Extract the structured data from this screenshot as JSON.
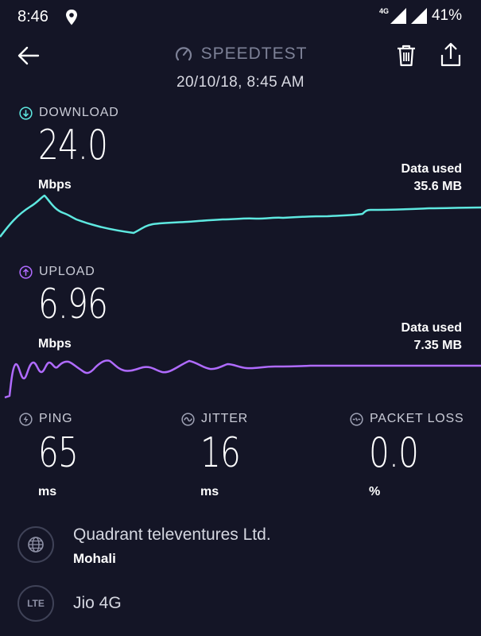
{
  "status_bar": {
    "time": "8:46",
    "network": "4G",
    "battery": "41%"
  },
  "header": {
    "title": "SPEEDTEST",
    "date": "20/10/18, 8:45 AM"
  },
  "download": {
    "label": "DOWNLOAD",
    "value": "24.0",
    "unit": "Mbps",
    "data_used_label": "Data used",
    "data_used_value": "35.6 MB",
    "color": "#5ee8e0"
  },
  "upload": {
    "label": "UPLOAD",
    "value": "6.96",
    "unit": "Mbps",
    "data_used_label": "Data used",
    "data_used_value": "7.35 MB",
    "color": "#b06bff"
  },
  "metrics": {
    "ping": {
      "label": "PING",
      "value": "65",
      "unit": "ms"
    },
    "jitter": {
      "label": "JITTER",
      "value": "16",
      "unit": "ms"
    },
    "packet_loss": {
      "label": "PACKET LOSS",
      "value": "0.0",
      "unit": "%"
    }
  },
  "provider": {
    "name": "Quadrant televentures Ltd.",
    "location": "Mohali",
    "icon": "globe-icon"
  },
  "connection": {
    "badge": "LTE",
    "name": "Jio 4G"
  },
  "colors": {
    "background": "#141526",
    "accent_download": "#5ee8e0",
    "accent_upload": "#b06bff"
  }
}
